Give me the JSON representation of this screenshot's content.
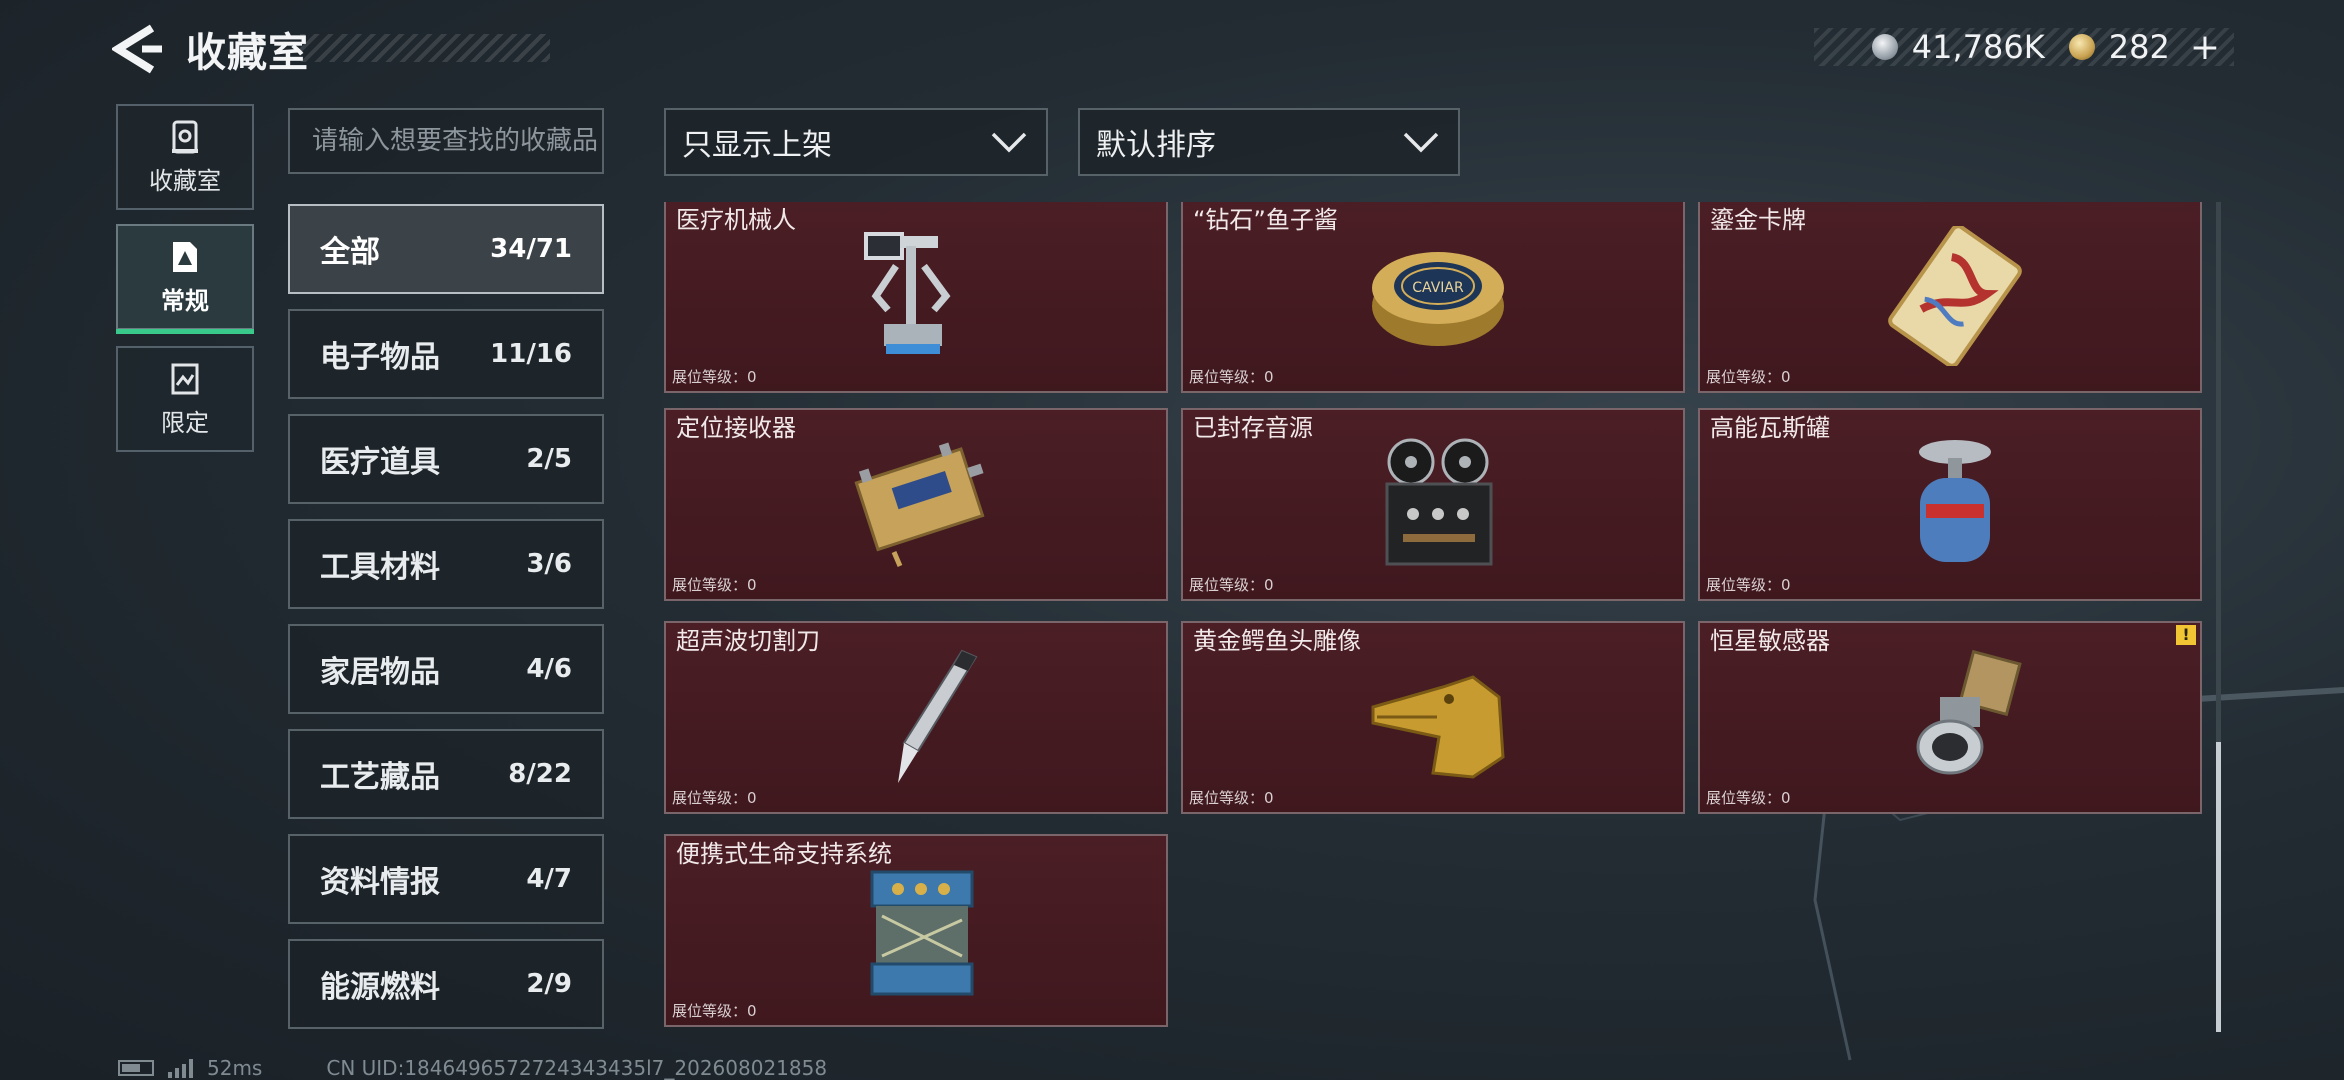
{
  "header": {
    "title": "收藏室",
    "currencies": [
      {
        "icon": "silver-coin-icon",
        "value": "41,786K"
      },
      {
        "icon": "gold-coin-icon",
        "value": "282"
      }
    ],
    "add_label": "+"
  },
  "left_tabs": [
    {
      "label": "收藏室",
      "icon": "collection-room-icon",
      "active": false
    },
    {
      "label": "常规",
      "icon": "regular-icon",
      "active": true
    },
    {
      "label": "限定",
      "icon": "limited-icon",
      "active": false
    }
  ],
  "search": {
    "placeholder": "请输入想要查找的收藏品"
  },
  "filters": {
    "display": "只显示上架",
    "sort": "默认排序"
  },
  "categories": [
    {
      "name": "全部",
      "count": "34/71",
      "active": true
    },
    {
      "name": "电子物品",
      "count": "11/16"
    },
    {
      "name": "医疗道具",
      "count": "2/5"
    },
    {
      "name": "工具材料",
      "count": "3/6"
    },
    {
      "name": "家居物品",
      "count": "4/6"
    },
    {
      "name": "工艺藏品",
      "count": "8/22"
    },
    {
      "name": "资料情报",
      "count": "4/7"
    },
    {
      "name": "能源燃料",
      "count": "2/9"
    }
  ],
  "items": [
    {
      "name": "医疗机械人",
      "level": "展位等级：0"
    },
    {
      "name": "“钻石”鱼子酱",
      "level": "展位等级：0"
    },
    {
      "name": "鎏金卡牌",
      "level": "展位等级：0"
    },
    {
      "name": "定位接收器",
      "level": "展位等级：0"
    },
    {
      "name": "已封存音源",
      "level": "展位等级：0"
    },
    {
      "name": "高能瓦斯罐",
      "level": "展位等级：0"
    },
    {
      "name": "超声波切割刀",
      "level": "展位等级：0"
    },
    {
      "name": "黄金鳄鱼头雕像",
      "level": "展位等级：0"
    },
    {
      "name": "恒星敏感器",
      "level": "展位等级：0",
      "warning": "!"
    },
    {
      "name": "便携式生命支持系统",
      "level": "展位等级：0"
    }
  ],
  "caviar_label": "CAVIAR",
  "footer": {
    "ping": "52ms",
    "uid": "CN UID:1846496572724343435l7_202608021858"
  },
  "colors": {
    "accent": "#38c98b",
    "item_bg": "#461c22",
    "warning": "#f2c535"
  }
}
